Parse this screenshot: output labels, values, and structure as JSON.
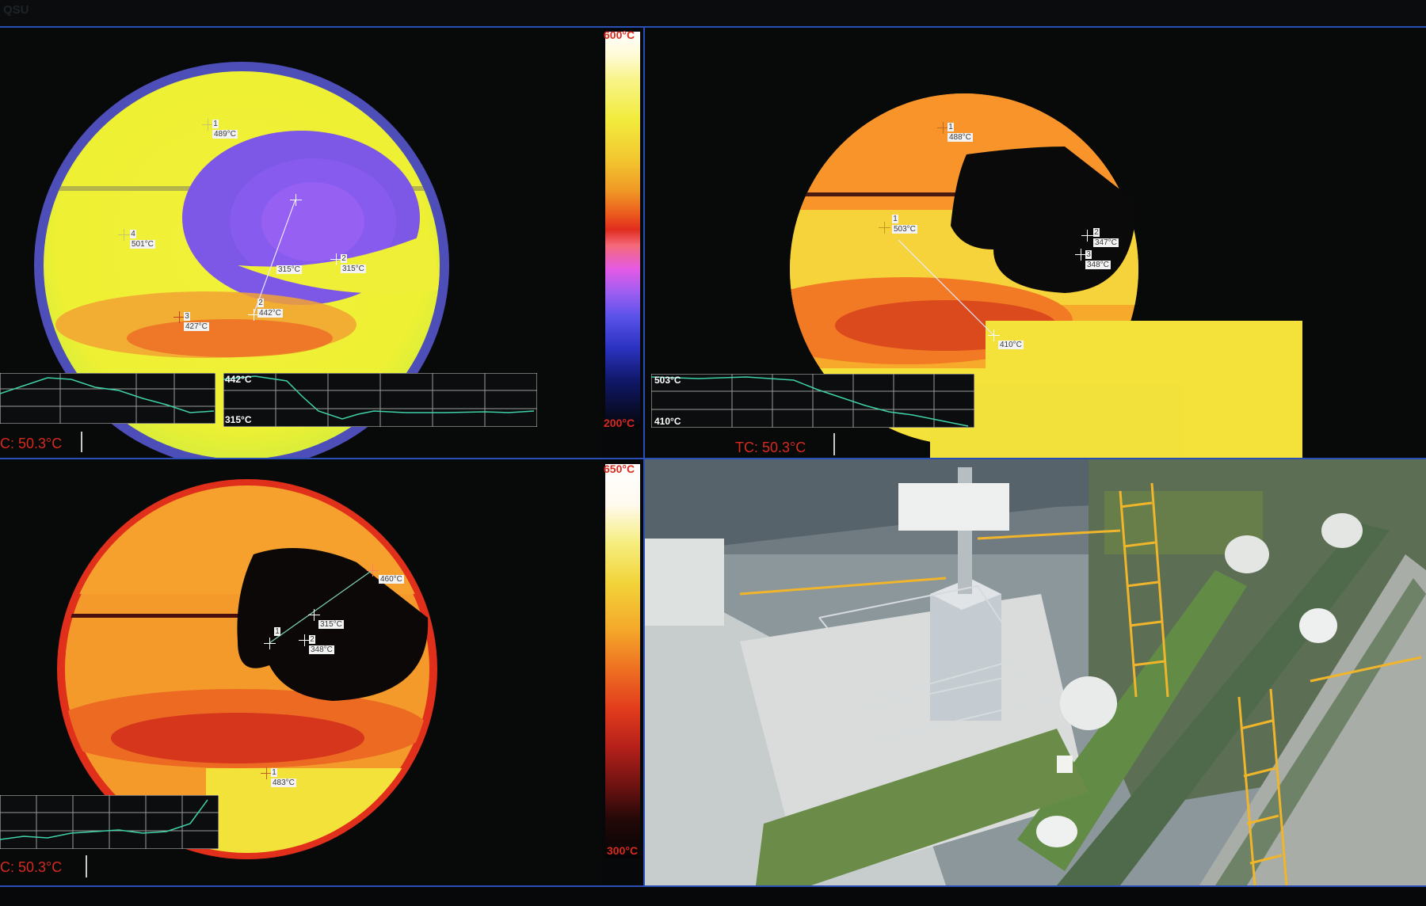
{
  "header": {
    "logo_text": "QSU"
  },
  "panels": {
    "thermal_a": {
      "points": [
        {
          "id": "1",
          "value": "489°C"
        },
        {
          "id": "4",
          "value": "501°C"
        },
        {
          "id": "",
          "value": "315°C"
        },
        {
          "id": "2",
          "value": "315°C"
        },
        {
          "id": "2",
          "value": "442°C"
        },
        {
          "id": "3",
          "value": "427°C"
        }
      ],
      "trend_max": "442°C",
      "trend_min": "315°C",
      "tc_label": "C: 50.3°C"
    },
    "thermal_b": {
      "points": [
        {
          "id": "1",
          "value": "488°C"
        },
        {
          "id": "1",
          "value": "503°C"
        },
        {
          "id": "2",
          "value": "347°C"
        },
        {
          "id": "3",
          "value": "348°C"
        },
        {
          "id": "",
          "value": "410°C"
        }
      ],
      "trend_max": "503°C",
      "trend_min": "410°C",
      "tc_label": "TC: 50.3°C"
    },
    "thermal_c": {
      "points": [
        {
          "id": "",
          "value": "460°C"
        },
        {
          "id": "1",
          "value": ""
        },
        {
          "id": "",
          "value": "315°C"
        },
        {
          "id": "2",
          "value": "348°C"
        },
        {
          "id": "1",
          "value": "483°C"
        }
      ],
      "tc_label": "C: 50.3°C"
    }
  },
  "scales": {
    "top": {
      "max": "600°C",
      "min": "200°C"
    },
    "bottom": {
      "max": "650°C",
      "min": "300°C"
    }
  },
  "colors": {
    "frame_line": "#2a4fb7",
    "tc_text": "#d82a1e",
    "trend_line": "#3fd2a9"
  },
  "camera_feed": {
    "scene": "live plant camera view"
  }
}
